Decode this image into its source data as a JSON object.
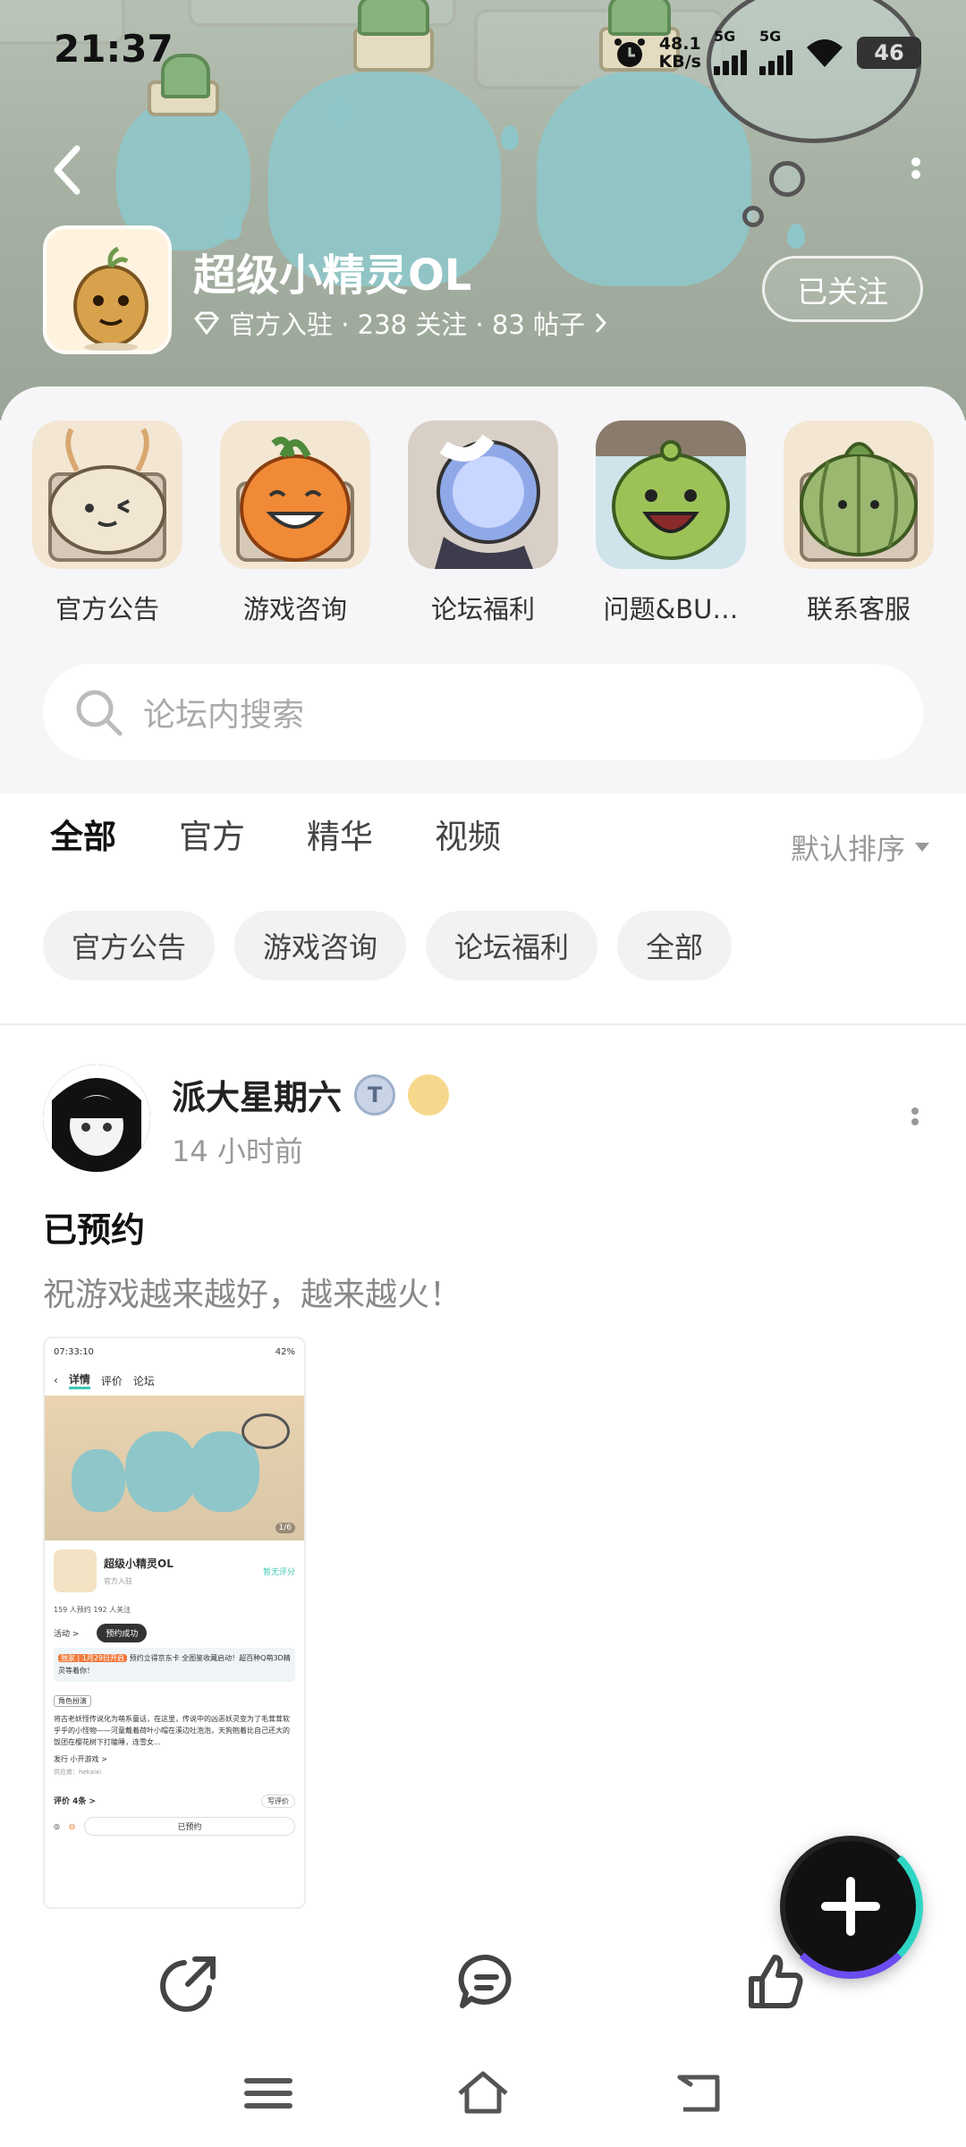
{
  "status_bar": {
    "time": "21:37",
    "net_speed": "48.1",
    "net_unit": "KB/s",
    "sim1": "5G",
    "sim2": "5G",
    "battery": "46"
  },
  "header": {
    "game_title": "超级小精灵OL",
    "sub_info": "官方入驻 · 238 关注 · 83 帖子",
    "follow_label": "已关注"
  },
  "categories": [
    {
      "label": "官方公告"
    },
    {
      "label": "游戏咨询"
    },
    {
      "label": "论坛福利"
    },
    {
      "label": "问题&BU…"
    },
    {
      "label": "联系客服"
    }
  ],
  "search": {
    "placeholder": "论坛内搜索"
  },
  "tabs": [
    {
      "label": "全部"
    },
    {
      "label": "官方"
    },
    {
      "label": "精华"
    },
    {
      "label": "视频"
    }
  ],
  "sort_label": "默认排序",
  "chips": [
    {
      "label": "官方公告"
    },
    {
      "label": "游戏咨询"
    },
    {
      "label": "论坛福利"
    },
    {
      "label": "全部"
    }
  ],
  "post": {
    "author": "派大星期六",
    "time": "14 小时前",
    "title": "已预约",
    "body": "祝游戏越来越好，越来越火！"
  },
  "thumbnail": {
    "time": "07:33:10",
    "battery": "42%",
    "tab_detail": "详情",
    "tab_review": "评价",
    "tab_forum": "论坛",
    "page": "1/6",
    "game_title": "超级小精灵OL",
    "no_rating": "暂无评分",
    "official": "官方入驻",
    "stats": "159 人预约 192 人关注",
    "activity": "活动 >",
    "toast": "预约成功",
    "promo": "预约立得京东卡 全图鉴收藏启动！超百种Q萌3D精灵等着你！",
    "promo_tag": "独家 | 1月29日开启",
    "role_tag": "角色扮演",
    "desc": "将古老妖怪传说化为萌系童话，在这里，传说中的凶恶妖灵变为了毛茸茸软乎乎的小怪物——河童戴着荷叶小帽在溪边吐泡泡，天狗抱着比自己还大的饭团在樱花树下打瞌睡，连雪女…",
    "publisher": "发行 小开游戏 >",
    "provider": "供应商：hekaixi",
    "reviews": "评价 4条 >",
    "write_review": "写评价",
    "reserved": "已预约"
  }
}
